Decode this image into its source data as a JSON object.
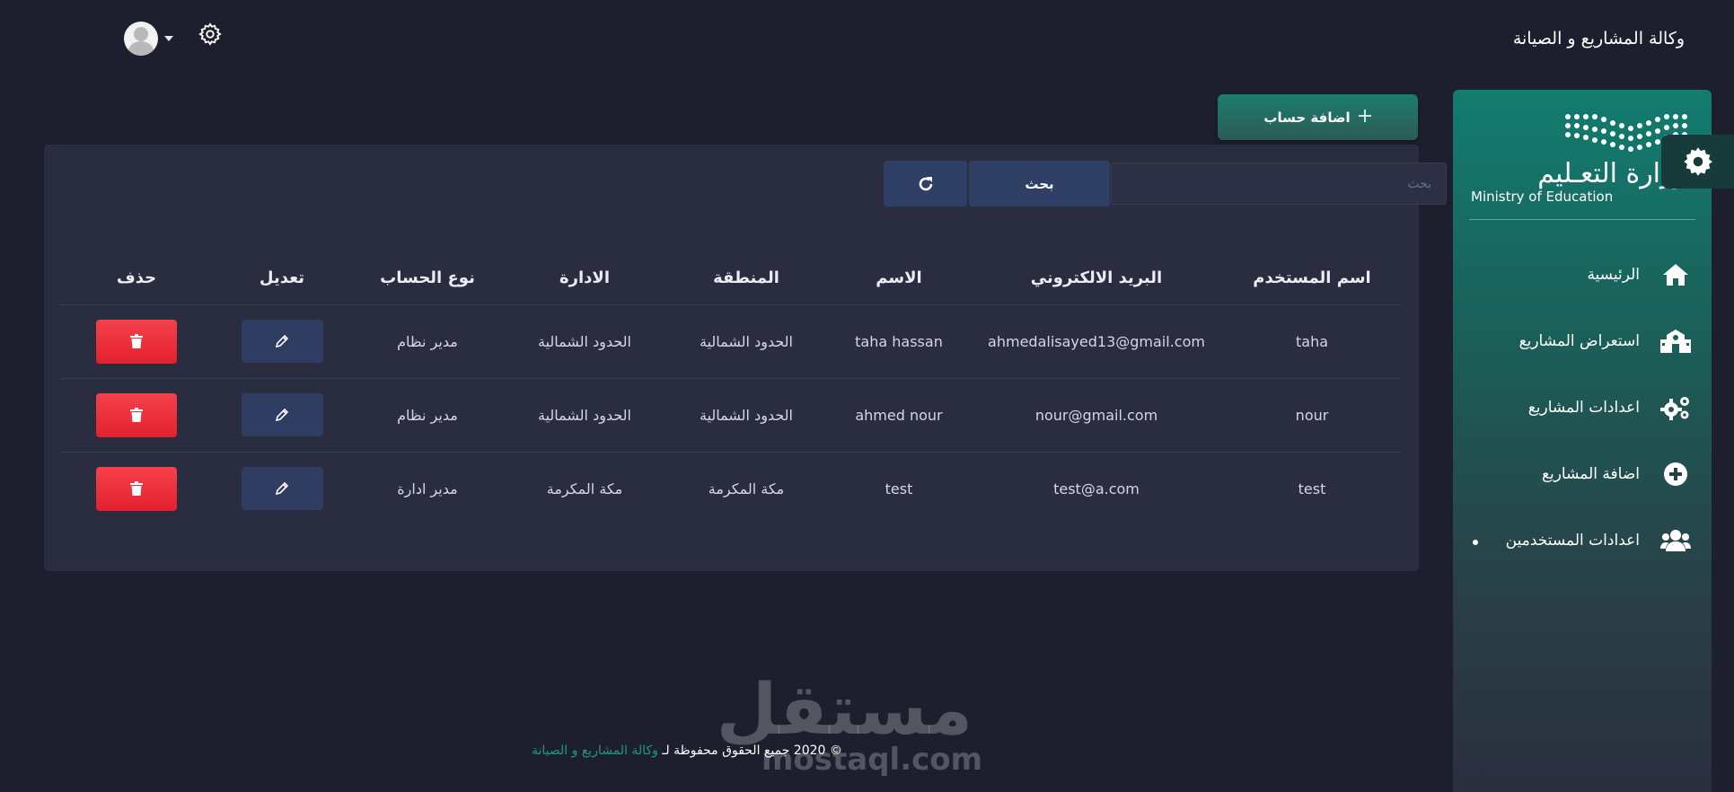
{
  "header": {
    "app_title": "وكالة المشاريع و الصيانة"
  },
  "sidebar": {
    "logo_ar": "وزارة التعـليم",
    "logo_en": "Ministry of Education",
    "items": [
      {
        "label": "الرئيسية",
        "icon": "home-icon"
      },
      {
        "label": "استعراض المشاريع",
        "icon": "school-icon"
      },
      {
        "label": "اعدادات المشاريع",
        "icon": "gears-icon"
      },
      {
        "label": "اضافة المشاريع",
        "icon": "plus-circle-icon"
      },
      {
        "label": "اعدادات المستخدمين",
        "icon": "users-icon",
        "active": true
      }
    ]
  },
  "toolbar": {
    "add_account_label": "اضافة حساب",
    "search_placeholder": "بحث",
    "search_button_label": "بحث"
  },
  "table": {
    "columns": [
      "اسم المستخدم",
      "البريد الالكتروني",
      "الاسم",
      "المنطقة",
      "الادارة",
      "نوع الحساب",
      "تعديل",
      "حذف"
    ],
    "rows": [
      {
        "username": "taha",
        "email": "ahmedalisayed13@gmail.com",
        "name": "taha hassan",
        "region": "الحدود الشمالية",
        "department": "الحدود الشمالية",
        "account_type": "مدير نظام"
      },
      {
        "username": "nour",
        "email": "nour@gmail.com",
        "name": "ahmed nour",
        "region": "الحدود الشمالية",
        "department": "الحدود الشمالية",
        "account_type": "مدير نظام"
      },
      {
        "username": "test",
        "email": "test@a.com",
        "name": "test",
        "region": "مكة المكرمة",
        "department": "مكة المكرمة",
        "account_type": "مدير ادارة"
      }
    ]
  },
  "footer": {
    "copyright": "© 2020 جميع الحقوق محفوظة لـ",
    "brand": "وكالة المشاريع و الصيانة"
  },
  "watermark": {
    "ar": "مستقل",
    "en": "mostaql.com"
  },
  "colors": {
    "background": "#1e1f2e",
    "card": "#2a2c40",
    "accent_green": "#1b7d6d",
    "button_blue": "#303f65",
    "danger_red": "#e5202e",
    "footer_brand": "#1d9a82"
  }
}
